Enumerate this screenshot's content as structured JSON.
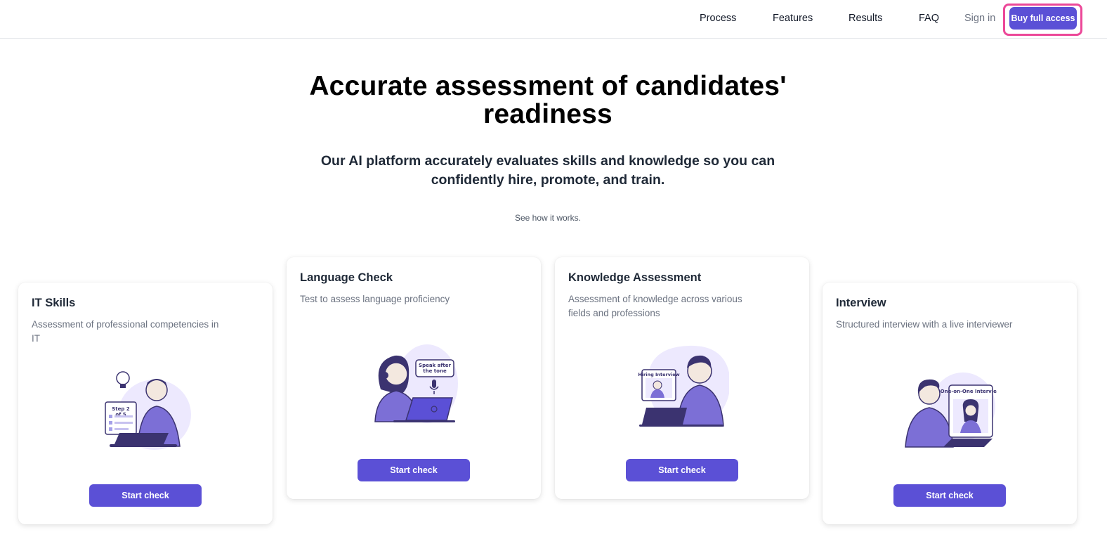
{
  "nav": {
    "items": [
      {
        "label": "Process"
      },
      {
        "label": "Features"
      },
      {
        "label": "Results"
      },
      {
        "label": "FAQ"
      }
    ],
    "sign_in": "Sign in",
    "cta": "Buy full access"
  },
  "hero": {
    "title": "Accurate assessment of candidates' readiness",
    "subtitle": "Our AI platform accurately evaluates skills and knowledge so you can confidently hire, promote, and train.",
    "link": "See how it works."
  },
  "cards": [
    {
      "title": "IT Skills",
      "description": "Assessment of professional competencies in IT",
      "button": "Start check",
      "illustration_text": "Step 2 of 5",
      "icon": "developer-illustration"
    },
    {
      "title": "Language Check",
      "description": "Test to assess language proficiency",
      "button": "Start check",
      "illustration_text": "Speak after the tone",
      "icon": "speaking-illustration"
    },
    {
      "title": "Knowledge Assessment",
      "description": "Assessment of knowledge across various fields and professions",
      "button": "Start check",
      "illustration_text": "Hiring Interview",
      "icon": "interview-call-illustration"
    },
    {
      "title": "Interview",
      "description": "Structured interview with a live interviewer",
      "button": "Start check",
      "illustration_text": "One-on-One Interview",
      "icon": "one-on-one-illustration"
    }
  ],
  "colors": {
    "accent": "#5b50d6",
    "highlight": "#ec4899",
    "illustration_light": "#ede9fe",
    "illustration_mid": "#7c6fd6",
    "illustration_dark": "#3b3370"
  }
}
